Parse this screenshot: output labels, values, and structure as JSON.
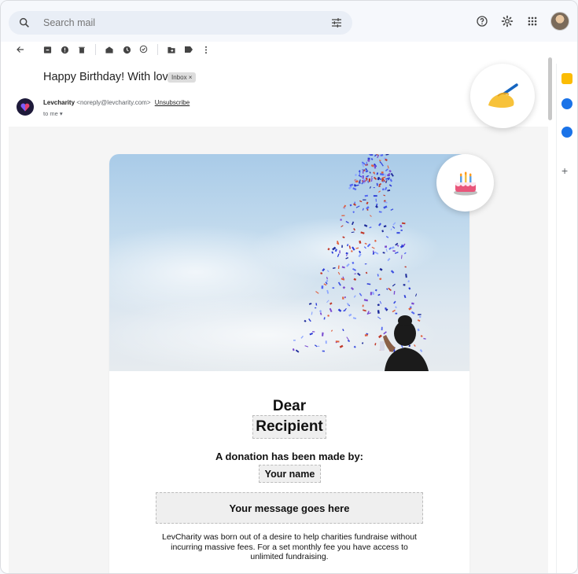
{
  "search": {
    "placeholder": "Search mail"
  },
  "email": {
    "subject": "Happy Birthday! With love.",
    "label": "Inbox ×",
    "sender_name": "Levcharity",
    "sender_email": "<noreply@levcharity.com>",
    "unsubscribe": "Unsubscribe",
    "recipient": "to me ▾"
  },
  "card": {
    "greeting": "Dear",
    "recipient_name": "Recipient",
    "donation_line": "A donation has been made by:",
    "donor_name": "Your name",
    "message": "Your message goes here",
    "description": "LevCharity was born out of a desire to help charities fundraise without incurring massive fees. For a set monthly fee you have access to unlimited fundraising."
  },
  "colors": {
    "accent": "#1a73e8",
    "keep": "#fbbc04",
    "tasks": "#1a73e8",
    "contacts": "#1a73e8",
    "brand_dark": "#1e1a3a"
  },
  "icons": {
    "search": "search-icon",
    "tune": "tune-icon",
    "help": "help-icon",
    "settings": "gear-icon",
    "apps": "apps-grid-icon"
  }
}
